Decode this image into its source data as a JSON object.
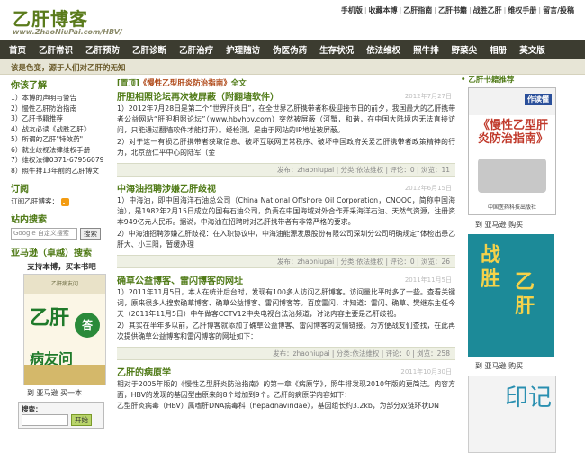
{
  "header": {
    "logo_title": "乙肝博客",
    "logo_url": "www.ZhaoNiuPai.com/HBV/",
    "toplinks": [
      "手机版",
      "收藏本博",
      "乙肝指南",
      "乙肝书籍",
      "战胜乙肝",
      "维权手册",
      "留言/投稿"
    ]
  },
  "nav": [
    "首页",
    "乙肝常识",
    "乙肝预防",
    "乙肝诊断",
    "乙肝治疗",
    "护理随访",
    "伪医伪药",
    "生存状况",
    "依法维权",
    "照牛排",
    "野菜尖",
    "相册",
    "英文版"
  ],
  "ticker": "该是色变，源于人们对乙肝的无知",
  "left": {
    "notice_title": "你该了解",
    "notice_items": [
      "1）本博的声明与警告",
      "2）慢性乙肝防治指南",
      "3）乙肝书籍推荐",
      "4）战友必读《战胜乙肝》",
      "5）所谓的乙肝\"特效药\"",
      "6）就业歧视法律维权手册",
      "7）维权法律0371-67956079",
      "8）照牛排13年前的乙肝博文"
    ],
    "subscribe_title": "订阅",
    "subscribe_label": "订阅乙肝博客：",
    "search_title": "站内搜索",
    "search_placeholder": "Google 自定义搜索",
    "search_button": "搜索",
    "amazon_title": "亚马逊（卓越）搜索",
    "amazon_note": "支持本博，买本书吧",
    "book_top": "乙肝病友问",
    "book_big": "乙肝",
    "book_circle": "答",
    "book_sub": "病友问",
    "buy_text": "到 亚马逊 买一本",
    "searchbox_label": "搜索：",
    "searchbox_button": "开始"
  },
  "main": {
    "tagline_prefix": "[置顶]",
    "tagline_book": "《慢性乙型肝炎防治指南》",
    "tagline_suffix": "全文",
    "posts": [
      {
        "title": "肝胆相照论坛再次被屏蔽（附翻墙软件）",
        "date": "2012年7月27日",
        "paragraphs": [
          "1）2012年7月28日是第二个“世界肝炎日”，在全世界乙肝携带者积极迎接节日的前夕，我国最大的乙肝携带者公益网站“肝胆相照论坛”（www.hbvhbv.com）突然被屏蔽（河蟹，和谐，在中国大陆境内无法直接访问，只能通过翻墙软件才能打开）。经检测，是由于网站的IP地址被屏蔽。",
          "2）对于这一有损乙肝携带者获取信息、破坏互联网正常秩序、破坏中国政府关爱乙肝携带者政策精神的行为，北京益仁平中心的陆军（金"
        ],
        "meta": "发布：zhaoniupai | 分类:依法维权 | 评论：0 | 浏览：11"
      },
      {
        "title": "中海油招聘涉嫌乙肝歧视",
        "date": "2012年6月15日",
        "paragraphs": [
          "1）中海油，即中国海洋石油总公司（China National Offshore Oil Corporation，CNOOC，简称中国海油），是1982年2月15日成立的国有石油公司，负责在中国海域对外合作开采海洋石油、天然气资源，注册资本949亿元人民币。据说，中海油在招聘时对乙肝携带者有非常严格的要求。",
          "2）中海油招聘涉嫌乙肝歧视：在入职协议中，中海油能源发展股份有限公司深圳分公司明确规定“体检出患乙肝大、小三阳，暂缓办理"
        ],
        "meta": "发布：zhaoniupai | 分类:依法维权 | 评论：0 | 浏览：26"
      },
      {
        "title": "确草公益博客、雷闪博客的网址",
        "date": "2011年11月5日",
        "paragraphs": [
          "1）2011年11月5日，本人在统计后台时，发现有100多人访问乙肝博客。访问量比平时多了一些。查看关键词，原来很多人搜索确草博客、确草公益博客、雷闪博客等。百度雷闪，才知道：雷闪、确草、樊继东主任今天（2011年11月5日）中午做客CCTV12中央电视台法治频道，讨论内容主要是乙肝歧视。",
          "2）其实在半年多以前，乙肝博客就添加了确草公益博客、雷闪博客的友情链接。为方便战友们查找，在此再次提供确草公益博客和雷闪博客的网址如下："
        ],
        "meta": "发布：zhaoniupai | 分类:依法维权 | 评论：0 | 浏览：258"
      },
      {
        "title": "乙肝的病原学",
        "date": "2011年10月30日",
        "paragraphs": [
          "相对于2005年版的《慢性乙型肝炎防治指南》的第一章《病原学》，照牛排发现2010年版的更简洁。内容方面，HBV的发现的基因型由原来的8个增加到9个。乙肝的病原学内容如下：",
          "乙型肝炎病毒（HBV）属嗜肝DNA病毒科（hepadnaviridae），基因组长约3.2kb，为部分双链环状DN"
        ],
        "meta": ""
      }
    ]
  },
  "right": {
    "books_title": "乙肝书籍推荐",
    "book1_author": "作读懂",
    "book1_title": "《慢性乙型肝炎防治指南》",
    "book1_pub": "中国医药科技出版社",
    "buy1": "到 亚马逊 购买",
    "book2_text_a": "战胜",
    "book2_text_b": "乙肝",
    "buy2": "到 亚马逊 购买",
    "book3_text": "印记"
  },
  "colors": {
    "brand_green": "#4f7a16",
    "nav_bg": "#3c3c30",
    "ticker_bg": "#e7e5d6",
    "meta_bg": "#eef0e4"
  }
}
